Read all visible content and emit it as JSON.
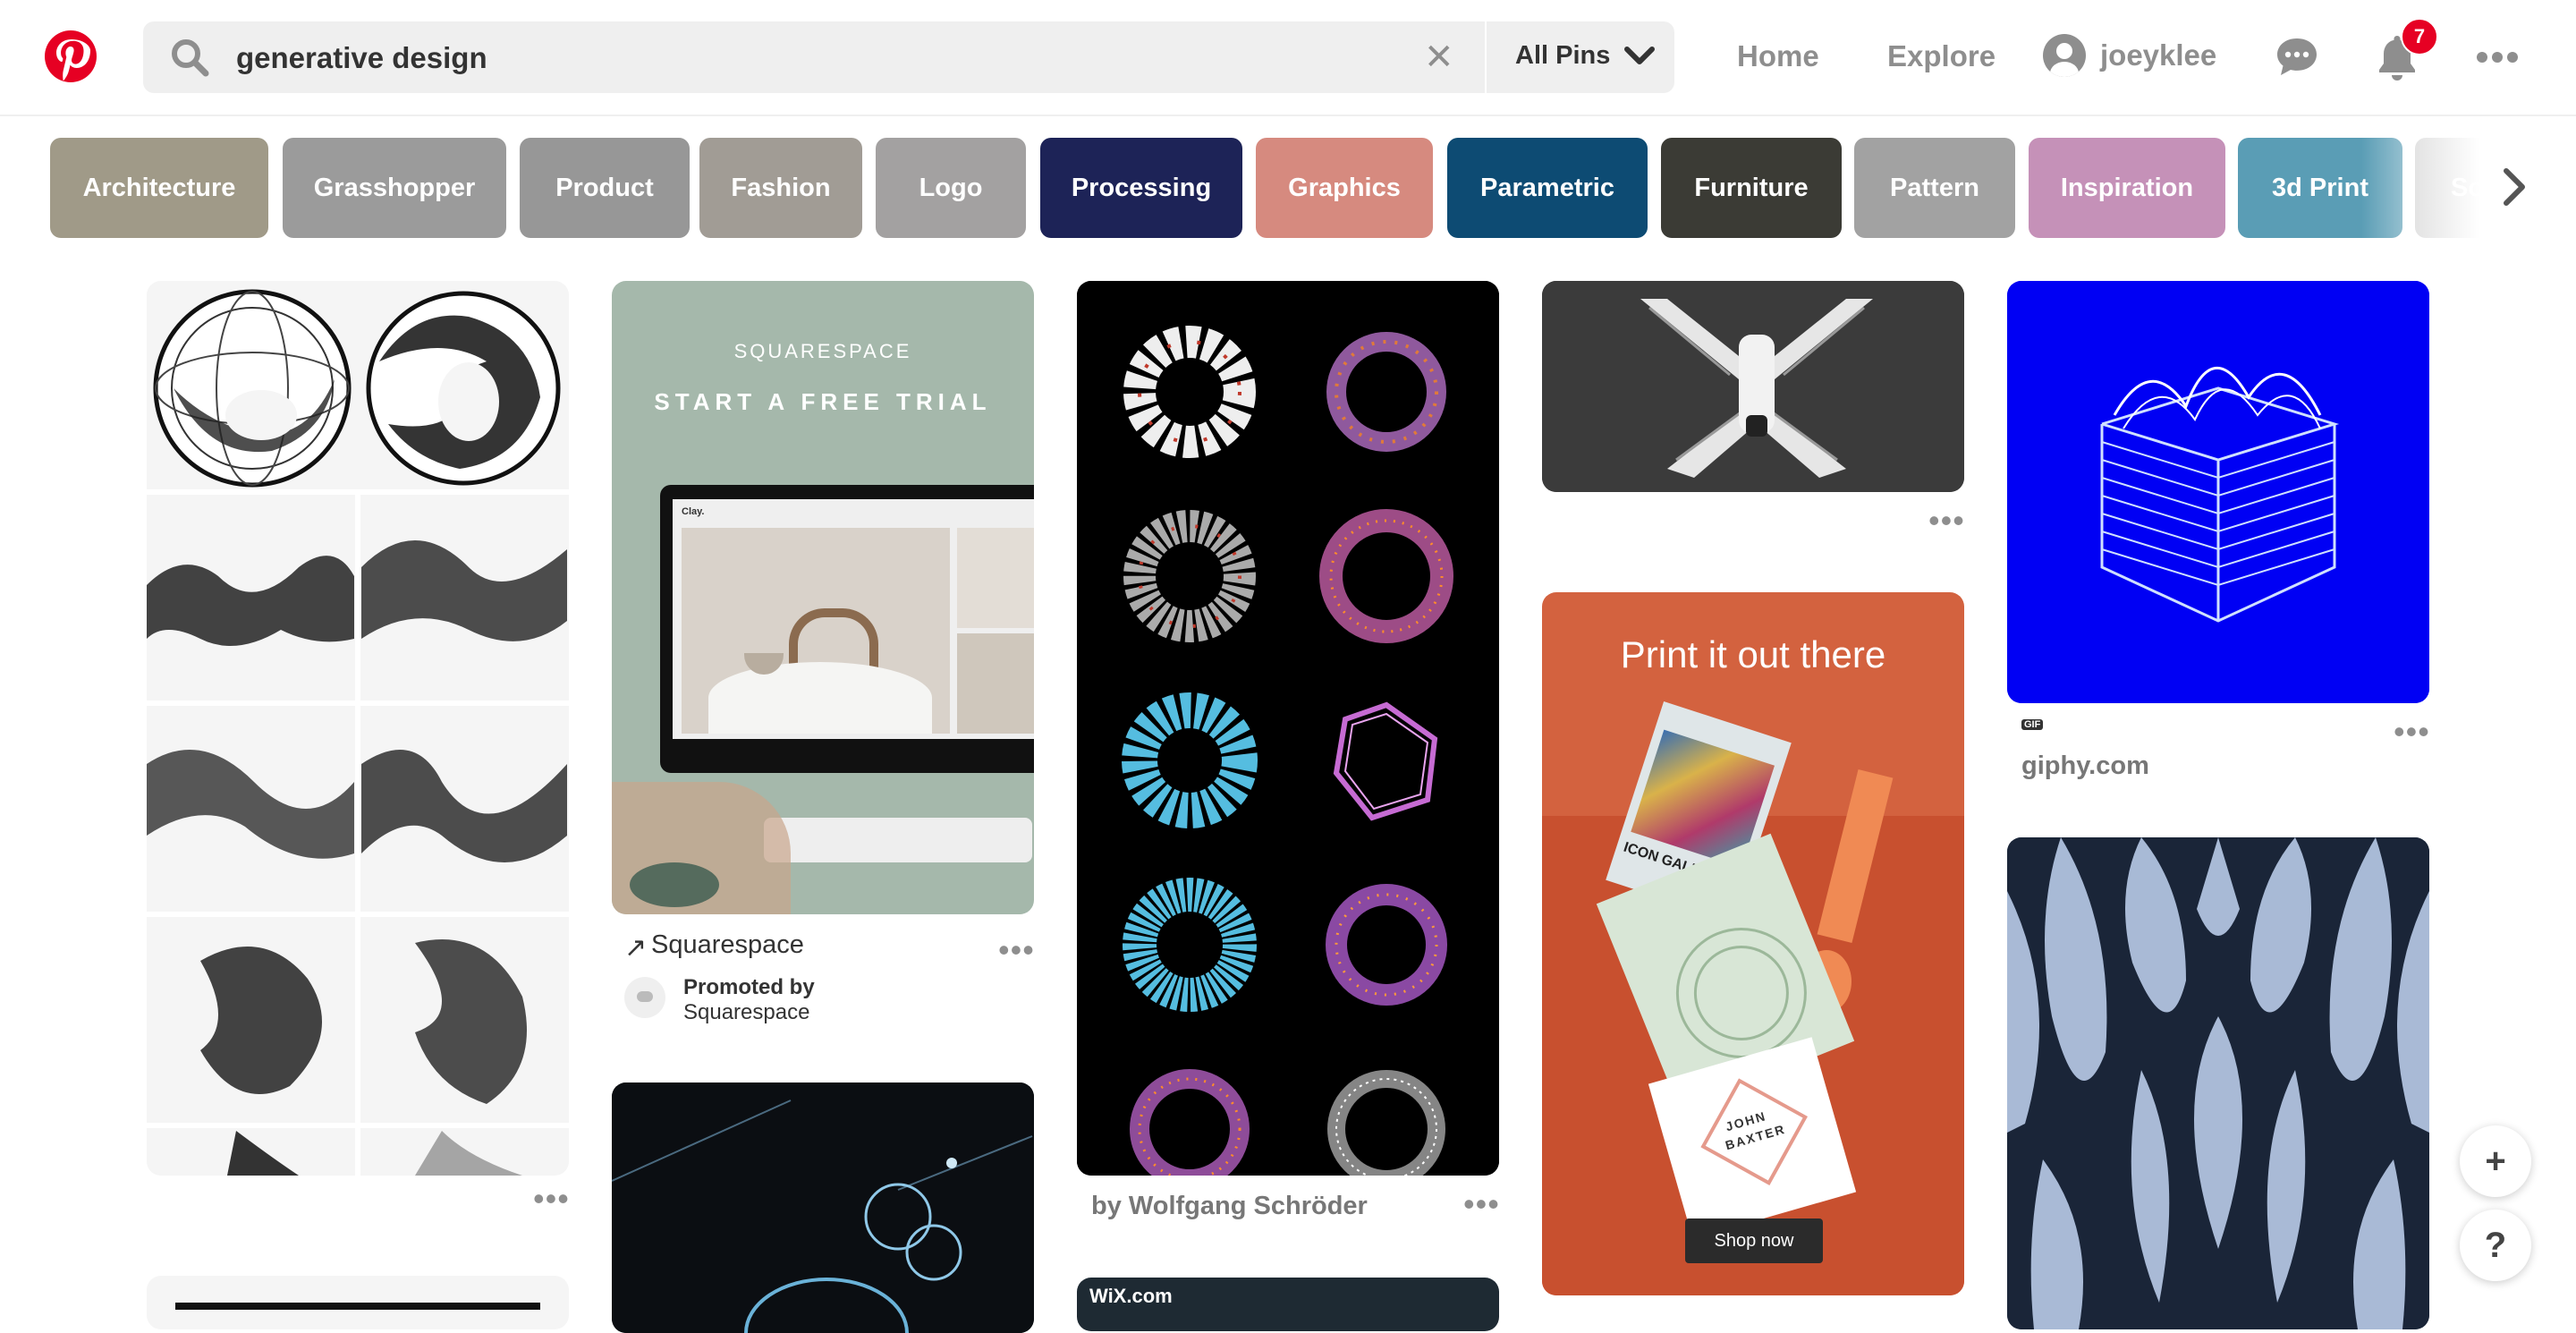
{
  "header": {
    "search": {
      "query": "generative design",
      "clear_symbol": "✕",
      "scope": "All Pins"
    },
    "nav": {
      "home": "Home",
      "explore": "Explore",
      "username": "joeyklee"
    },
    "notifications_count": "7"
  },
  "chips": [
    {
      "label": "Architecture",
      "color": "#a09a88"
    },
    {
      "label": "Grasshopper",
      "color": "#9b9b9b"
    },
    {
      "label": "Product",
      "color": "#979797"
    },
    {
      "label": "Fashion",
      "color": "#a19c95"
    },
    {
      "label": "Logo",
      "color": "#a3a1a1"
    },
    {
      "label": "Processing",
      "color": "#1d2357"
    },
    {
      "label": "Graphics",
      "color": "#d68a7f"
    },
    {
      "label": "Parametric",
      "color": "#0d4b73"
    },
    {
      "label": "Furniture",
      "color": "#3b3b35"
    },
    {
      "label": "Pattern",
      "color": "#a2a2a2"
    },
    {
      "label": "Inspiration",
      "color": "#c591b8"
    },
    {
      "label": "3d Print",
      "color": "#5a9db5"
    },
    {
      "label": "Sc",
      "color": "#cccccc"
    }
  ],
  "pins": {
    "squarespace_ad": {
      "brand": "SQUARESPACE",
      "headline": "START A FREE TRIAL",
      "site_label": "Clay.",
      "source": "Squarespace",
      "promoted_label": "Promoted by",
      "promoter": "Squarespace"
    },
    "schroder": {
      "caption": "by Wolfgang Schröder"
    },
    "print_ad": {
      "headline": "Print it out there",
      "gallery": "ICON GALLERY",
      "card_name_1": "JOHN",
      "card_name_2": "BAXTER",
      "cta": "Shop now"
    },
    "giphy": {
      "badge": "GIF",
      "source": "giphy.com"
    },
    "wix": {
      "logo": "WiX.com"
    }
  },
  "fab": {
    "add": "+",
    "help": "?"
  },
  "icons": {
    "logo": "pinterest-logo-icon",
    "search": "search-icon",
    "chevron": "chevron-down-icon",
    "messages": "chat-bubbles-icon",
    "notifications": "bell-icon",
    "more": "ellipsis-icon"
  }
}
